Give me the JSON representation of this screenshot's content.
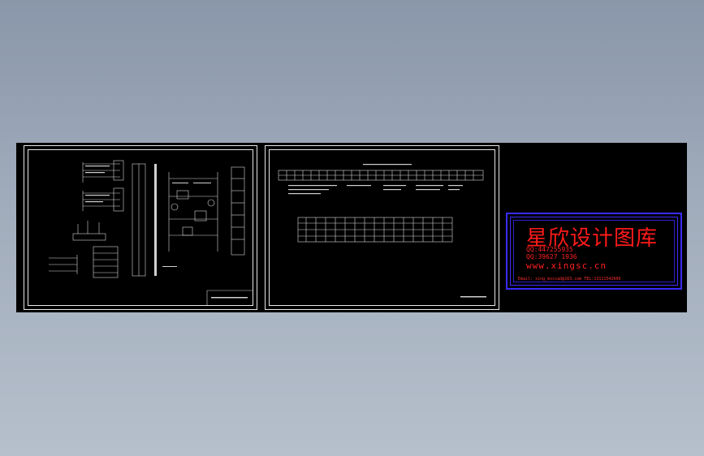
{
  "watermark": {
    "title": "星欣设计图库",
    "qq1": "QQ:447255935",
    "qq2": "QQ:39627 1936",
    "url": "www.xingsc.cn",
    "contact": "Email:  xing_msccad@163.com   TEL:13111542600"
  },
  "colors": {
    "canvas": "#000000",
    "line": "#e8e8e8",
    "watermark_text": "#ff1a1a",
    "watermark_border": "#3a2cff"
  }
}
